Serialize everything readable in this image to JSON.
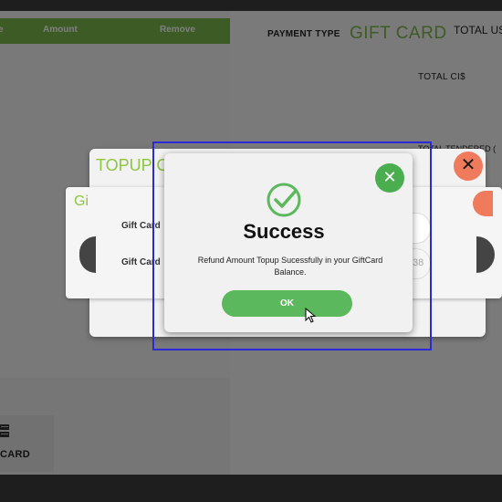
{
  "order_table": {
    "headers": [
      "e",
      "Amount",
      "Remove"
    ]
  },
  "payment": {
    "type_label": "PAYMENT TYPE",
    "type_value": "GIFT CARD",
    "total_us_label": "TOTAL US",
    "total_ci_label": "TOTAL CI$",
    "total_tendered_label": "TOTAL TENDERED ("
  },
  "sidebar": {
    "gift_card_button_label": "CARD",
    "gift_card_icon": "gift-card-icon"
  },
  "topup_dialog": {
    "title": "TOPUP C",
    "close_icon": "close-icon",
    "inner_title": "Gi",
    "fields": [
      {
        "label": "Gift Card"
      },
      {
        "label": "Gift Card",
        "value_fragment": "38"
      }
    ]
  },
  "success_dialog": {
    "icon": "check-circle-icon",
    "title": "Success",
    "message": "Refund Amount Topup Sucessfully in your GiftCard Balance.",
    "ok_label": "OK",
    "close_icon": "close-icon"
  },
  "colors": {
    "accent_green": "#7ab648",
    "success_green": "#5cb85c",
    "close_red": "#f07a5c",
    "focus_outline": "#2b2bd6"
  }
}
